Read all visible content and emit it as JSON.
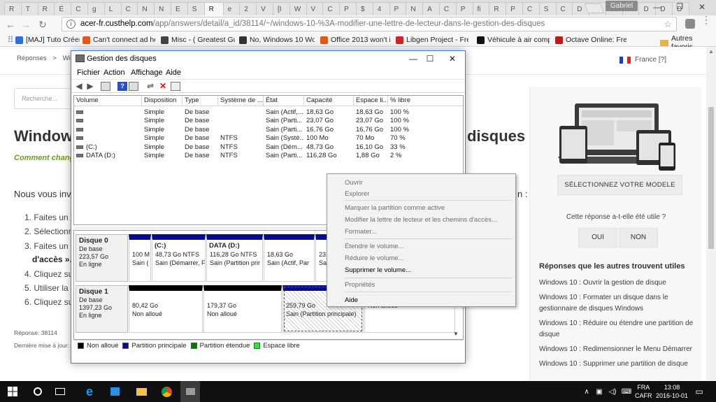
{
  "browser": {
    "tabs": [
      "R",
      "T",
      "R",
      "É",
      "C",
      "g",
      "L",
      "C",
      "N",
      "N",
      "E",
      "S",
      "R",
      "e",
      "2",
      "V",
      "[I",
      "W",
      "V",
      "C",
      "P",
      "$",
      "4",
      "P",
      "N",
      "A",
      "C",
      "P",
      "fi",
      "R",
      "P",
      "C",
      "S",
      "C",
      "D",
      "D",
      "D",
      "D",
      "D",
      "D",
      "D"
    ],
    "active_tab": "C",
    "profile": "Gabriel",
    "url_prefix": "acer-fr.custhelp.com",
    "url_rest": "/app/answers/detail/a_id/38114/~/windows-10-%3A-modifier-une-lettre-de-lecteur-dans-le-gestion-des-disques",
    "bookmarks": [
      {
        "label": "[MAJ] Tuto Créer Por",
        "color": "#2f6fd0"
      },
      {
        "label": "Can't connect ad hoc",
        "color": "#e05a1c"
      },
      {
        "label": "Misc - ( Greatest Guit",
        "color": "#444444"
      },
      {
        "label": "No, Windows 10 Won",
        "color": "#333333"
      },
      {
        "label": "Office 2013 won't inst",
        "color": "#e05a1c"
      },
      {
        "label": "Libgen Project - Free",
        "color": "#c62828"
      },
      {
        "label": "Véhicule à air compri",
        "color": "#111111"
      },
      {
        "label": "Octave Online: Free In",
        "color": "#b71c1c"
      }
    ],
    "bookmarks_icon_letters": [
      "",
      "",
      "",
      "HTG",
      "",
      "",
      "W",
      ""
    ],
    "other_bookmarks": "Autres favoris"
  },
  "page": {
    "breadcrumb": [
      "Réponses",
      ">",
      "Wind"
    ],
    "language": "France [?]",
    "search_placeholder": "Recherche...",
    "title_left": "Window",
    "title_right": "disques",
    "subtitle": "Comment chang",
    "intro": "Nous vous inv",
    "intro_end": "n :",
    "steps": [
      "1. Faites un cl",
      "2. Sélectionne",
      "3. Faites un cl",
      "4. Cliquez sur",
      "5. Utiliser la li",
      "6. Cliquez sur"
    ],
    "step3_cont": "d'accès ».",
    "answer_ref": "Réponse: 38114",
    "last_update": "Dernière mise à jour: "
  },
  "sidebar": {
    "select_model": "SÉLECTIONNEZ VOTRE MODELE",
    "useful_question": "Cette réponse a-t-elle été utile ?",
    "yes": "OUI",
    "no": "NON",
    "related_title": "Réponses que les autres trouvent utiles",
    "related": [
      "Windows 10 : Ouvrir la gestion de disque",
      "Windows 10 : Formater un disque dans le gestionnaire de disques Windows",
      "Windows 10 : Réduire ou étendre une partition de disque",
      "Windows 10 : Redimensionner le Menu Démarrer",
      "Windows 10 : Supprimer une partition de disque"
    ]
  },
  "diskmgmt": {
    "title": "Gestion des disques",
    "menu": [
      "Fichier",
      "Action",
      "Affichage",
      "Aide"
    ],
    "columns": [
      "Volume",
      "Disposition",
      "Type",
      "Système de ...",
      "État",
      "Capacité",
      "Espace li...",
      "% libre"
    ],
    "rows": [
      [
        "",
        "Simple",
        "De base",
        "",
        "Sain (Actif,...",
        "18,63 Go",
        "18,63 Go",
        "100 %"
      ],
      [
        "",
        "Simple",
        "De base",
        "",
        "Sain (Parti...",
        "23,07 Go",
        "23,07 Go",
        "100 %"
      ],
      [
        "",
        "Simple",
        "De base",
        "",
        "Sain (Parti...",
        "16,76 Go",
        "16,76 Go",
        "100 %"
      ],
      [
        "",
        "Simple",
        "De base",
        "NTFS",
        "Sain (Systè...",
        "100 Mo",
        "70 Mo",
        "70 %"
      ],
      [
        "(C:)",
        "Simple",
        "De base",
        "NTFS",
        "Sain (Dém...",
        "48,73 Go",
        "16,10 Go",
        "33 %"
      ],
      [
        "DATA (D:)",
        "Simple",
        "De base",
        "NTFS",
        "Sain (Parti...",
        "116,28 Go",
        "1,88 Go",
        "2 %"
      ]
    ],
    "disk0": {
      "name": "Disque 0",
      "type": "De base",
      "size": "223,57 Go",
      "status": "En ligne",
      "parts": [
        {
          "title": "",
          "line1": "100 M",
          "line2": "Sain (",
          "color": "#0a0a8c"
        },
        {
          "title": "(C:)",
          "line1": "48,73 Go NTFS",
          "line2": "Sain (Démarrer, F",
          "color": "#0a0a8c"
        },
        {
          "title": "DATA  (D:)",
          "line1": "116,28 Go NTFS",
          "line2": "Sain (Partition prir",
          "color": "#0a0a8c"
        },
        {
          "title": "",
          "line1": "18,63 Go",
          "line2": "Sain (Actif, Par",
          "color": "#0a0a8c"
        },
        {
          "title": "",
          "line1": "23,0",
          "line2": "Sain",
          "color": "#0a0a8c"
        }
      ]
    },
    "disk1": {
      "name": "Disque 1",
      "type": "De base",
      "size": "1397,23 Go",
      "status": "En ligne",
      "parts": [
        {
          "title": "",
          "line1": "80,42 Go",
          "line2": "Non alloué",
          "color": "#000000"
        },
        {
          "title": "",
          "line1": "179,37 Go",
          "line2": "Non alloué",
          "color": "#000000"
        },
        {
          "title": "",
          "line1": "259,79 Go",
          "line2": "Sain (Partition principale)",
          "color": "#0a0a8c"
        },
        {
          "title": "",
          "line1": "",
          "line2": "Non alloué",
          "color": "#000000"
        }
      ]
    },
    "legend": [
      {
        "label": "Non alloué",
        "color": "#000000"
      },
      {
        "label": "Partition principale",
        "color": "#0a0a8c"
      },
      {
        "label": "Partition étendue",
        "color": "#007a00"
      },
      {
        "label": "Espace libre",
        "color": "#2ee82e"
      }
    ]
  },
  "context_menu": {
    "items": [
      {
        "label": "Ouvrir",
        "enabled": false
      },
      {
        "label": "Explorer",
        "enabled": false
      },
      {
        "label": "Marquer la partition comme active",
        "enabled": false
      },
      {
        "label": "Modifier la lettre de lecteur et les chemins d'accès...",
        "enabled": false
      },
      {
        "label": "Formater...",
        "enabled": false
      },
      {
        "label": "Étendre le volume...",
        "enabled": false
      },
      {
        "label": "Réduire le volume...",
        "enabled": false
      },
      {
        "label": "Supprimer le volume...",
        "enabled": true
      },
      {
        "label": "Propriétés",
        "enabled": false
      },
      {
        "label": "Aide",
        "enabled": true
      }
    ]
  },
  "taskbar": {
    "lang_line1": "FRA",
    "lang_line2": "CAFR",
    "time": "13:08",
    "date": "2016-10-01"
  }
}
